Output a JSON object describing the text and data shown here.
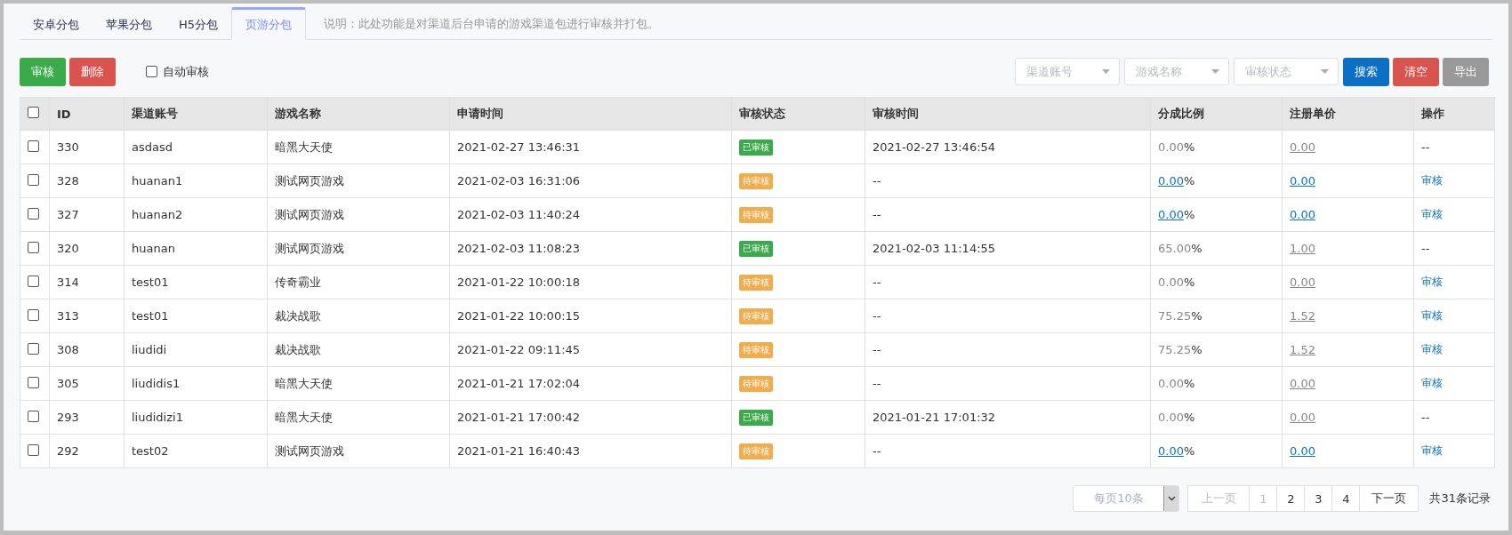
{
  "tabs": [
    {
      "label": "安卓分包",
      "selected": false
    },
    {
      "label": "苹果分包",
      "selected": false
    },
    {
      "label": "H5分包",
      "selected": false
    },
    {
      "label": "页游分包",
      "selected": true
    }
  ],
  "note": "说明：此处功能是对渠道后台申请的游戏渠道包进行审核并打包。",
  "toolbar": {
    "approve_button": "审核",
    "delete_button": "删除",
    "auto_approve": {
      "label": "自动审核",
      "checked": false
    }
  },
  "filters": [
    {
      "placeholder": "渠道账号"
    },
    {
      "placeholder": "游戏名称"
    },
    {
      "placeholder": "审核状态"
    }
  ],
  "filter_buttons": [
    {
      "label": "搜索",
      "kind": "primary"
    },
    {
      "label": "清空",
      "kind": "danger"
    },
    {
      "label": "导出",
      "kind": "neutral"
    }
  ],
  "table": {
    "select_all": false,
    "columns": [
      "ID",
      "渠道账号",
      "游戏名称",
      "申请时间",
      "审核状态",
      "审核时间",
      "分成比例",
      "注册单价",
      "操作"
    ],
    "rows": [
      {
        "checked": false,
        "id": "330",
        "account": "asdasd",
        "game": "暗黑大天使",
        "applied": "2021-02-27 13:46:31",
        "status": {
          "label": "已审核",
          "kind": "approved"
        },
        "reviewed": "2021-02-27 13:46:54",
        "ratio": "0.00",
        "ratio_unit": "%",
        "ratio_link": false,
        "price": "0.00",
        "price_link": false,
        "action": {
          "label": "--",
          "kind": "none"
        }
      },
      {
        "checked": false,
        "id": "328",
        "account": "huanan1",
        "game": "测试网页游戏",
        "applied": "2021-02-03 16:31:06",
        "status": {
          "label": "待审核",
          "kind": "pending"
        },
        "reviewed": "--",
        "ratio": "0.00",
        "ratio_unit": "%",
        "ratio_link": true,
        "price": "0.00",
        "price_link": true,
        "action": {
          "label": "审核",
          "kind": "link"
        }
      },
      {
        "checked": false,
        "id": "327",
        "account": "huanan2",
        "game": "测试网页游戏",
        "applied": "2021-02-03 11:40:24",
        "status": {
          "label": "待审核",
          "kind": "pending"
        },
        "reviewed": "--",
        "ratio": "0.00",
        "ratio_unit": "%",
        "ratio_link": true,
        "price": "0.00",
        "price_link": true,
        "action": {
          "label": "审核",
          "kind": "link"
        }
      },
      {
        "checked": false,
        "id": "320",
        "account": "huanan",
        "game": "测试网页游戏",
        "applied": "2021-02-03 11:08:23",
        "status": {
          "label": "已审核",
          "kind": "approved"
        },
        "reviewed": "2021-02-03 11:14:55",
        "ratio": "65.00",
        "ratio_unit": "%",
        "ratio_link": false,
        "price": "1.00",
        "price_link": false,
        "action": {
          "label": "--",
          "kind": "none"
        }
      },
      {
        "checked": false,
        "id": "314",
        "account": "test01",
        "game": "传奇霸业",
        "applied": "2021-01-22 10:00:18",
        "status": {
          "label": "待审核",
          "kind": "pending"
        },
        "reviewed": "--",
        "ratio": "0.00",
        "ratio_unit": "%",
        "ratio_link": false,
        "price": "0.00",
        "price_link": false,
        "action": {
          "label": "审核",
          "kind": "link"
        }
      },
      {
        "checked": false,
        "id": "313",
        "account": "test01",
        "game": "裁决战歌",
        "applied": "2021-01-22 10:00:15",
        "status": {
          "label": "待审核",
          "kind": "pending"
        },
        "reviewed": "--",
        "ratio": "75.25",
        "ratio_unit": "%",
        "ratio_link": false,
        "price": "1.52",
        "price_link": false,
        "action": {
          "label": "审核",
          "kind": "link"
        }
      },
      {
        "checked": false,
        "id": "308",
        "account": "liudidi",
        "game": "裁决战歌",
        "applied": "2021-01-22 09:11:45",
        "status": {
          "label": "待审核",
          "kind": "pending"
        },
        "reviewed": "--",
        "ratio": "75.25",
        "ratio_unit": "%",
        "ratio_link": false,
        "price": "1.52",
        "price_link": false,
        "action": {
          "label": "审核",
          "kind": "link"
        }
      },
      {
        "checked": false,
        "id": "305",
        "account": "liudidis1",
        "game": "暗黑大天使",
        "applied": "2021-01-21 17:02:04",
        "status": {
          "label": "待审核",
          "kind": "pending"
        },
        "reviewed": "--",
        "ratio": "0.00",
        "ratio_unit": "%",
        "ratio_link": false,
        "price": "0.00",
        "price_link": false,
        "action": {
          "label": "审核",
          "kind": "link"
        }
      },
      {
        "checked": false,
        "id": "293",
        "account": "liudidizi1",
        "game": "暗黑大天使",
        "applied": "2021-01-21 17:00:42",
        "status": {
          "label": "已审核",
          "kind": "approved"
        },
        "reviewed": "2021-01-21 17:01:32",
        "ratio": "0.00",
        "ratio_unit": "%",
        "ratio_link": false,
        "price": "0.00",
        "price_link": false,
        "action": {
          "label": "--",
          "kind": "none"
        }
      },
      {
        "checked": false,
        "id": "292",
        "account": "test02",
        "game": "测试网页游戏",
        "applied": "2021-01-21 16:40:43",
        "status": {
          "label": "待审核",
          "kind": "pending"
        },
        "reviewed": "--",
        "ratio": "0.00",
        "ratio_unit": "%",
        "ratio_link": true,
        "price": "0.00",
        "price_link": true,
        "action": {
          "label": "审核",
          "kind": "link"
        }
      }
    ]
  },
  "pagination": {
    "page_size": "每页10条",
    "prev": {
      "label": "上一页",
      "disabled": true
    },
    "pages": [
      {
        "label": "1",
        "selected": true
      },
      {
        "label": "2",
        "selected": false
      },
      {
        "label": "3",
        "selected": false
      },
      {
        "label": "4",
        "selected": false
      }
    ],
    "next": {
      "label": "下一页",
      "disabled": false
    },
    "total": "共31条记录"
  }
}
